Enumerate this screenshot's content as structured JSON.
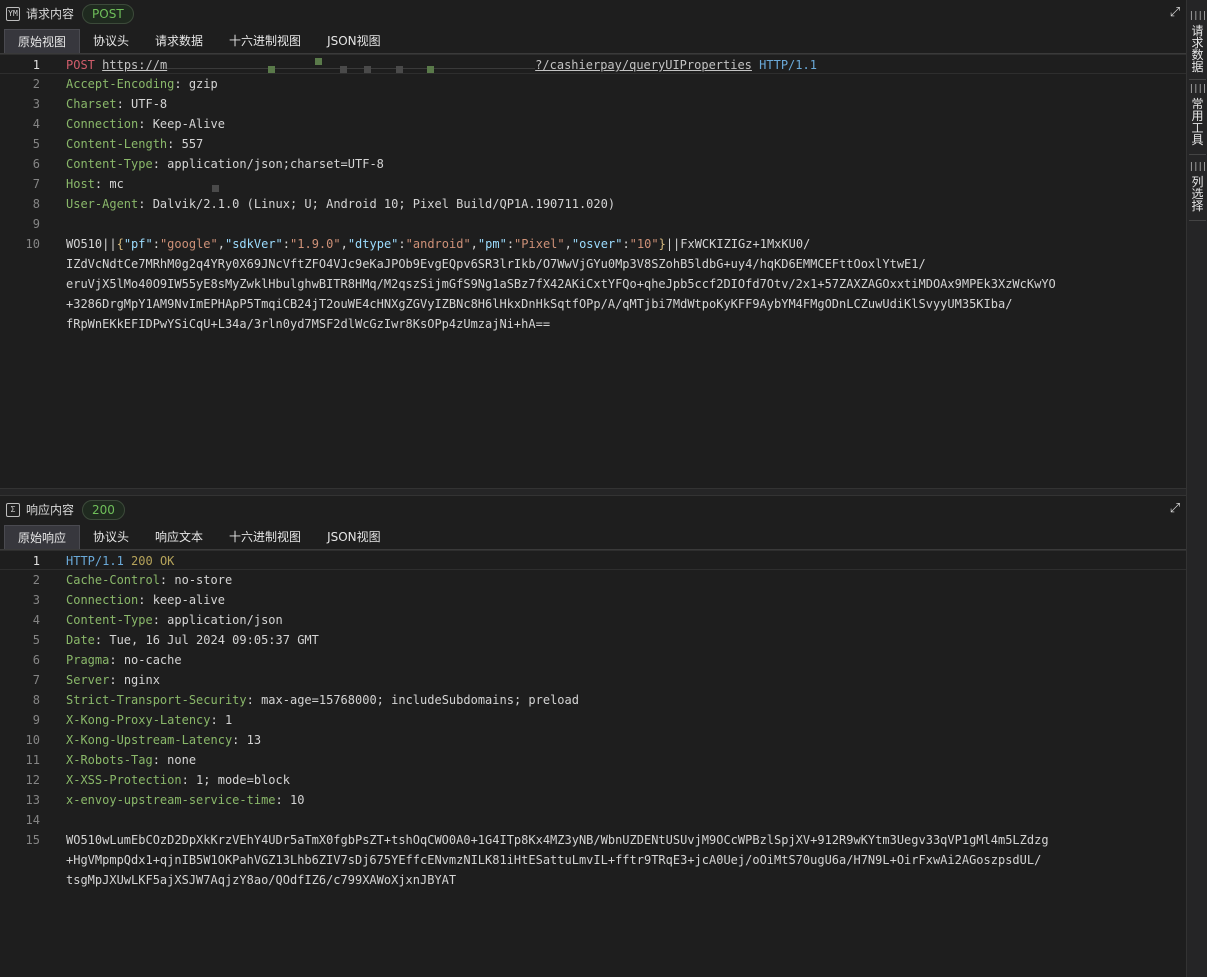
{
  "request": {
    "title": "请求内容",
    "method_badge": "POST",
    "icon": "request-window-icon",
    "tabs": [
      "原始视图",
      "协议头",
      "请求数据",
      "十六进制视图",
      "JSON视图"
    ],
    "line_numbers": [
      "1",
      "2",
      "3",
      "4",
      "5",
      "6",
      "7",
      "8",
      "9",
      "10"
    ],
    "start_line": {
      "method": "POST",
      "url_start": "https://m",
      "url_end": "?/cashierpay/queryUIProperties",
      "version": "HTTP/1.1"
    },
    "headers": [
      {
        "name": "Accept-Encoding",
        "value": "gzip"
      },
      {
        "name": "Charset",
        "value": "UTF-8"
      },
      {
        "name": "Connection",
        "value": "Keep-Alive"
      },
      {
        "name": "Content-Length",
        "value": "557"
      },
      {
        "name": "Content-Type",
        "value": "application/json;charset=UTF-8"
      },
      {
        "name": "Host",
        "value": "mc"
      },
      {
        "name": "User-Agent",
        "value": "Dalvik/2.1.0 (Linux; U; Android 10; Pixel Build/QP1A.190711.020)"
      }
    ],
    "body": {
      "prefix": "WO510||",
      "json_pairs": [
        {
          "key": "\"pf\"",
          "value": "\"google\""
        },
        {
          "key": "\"sdkVer\"",
          "value": "\"1.9.0\""
        },
        {
          "key": "\"dtype\"",
          "value": "\"android\""
        },
        {
          "key": "\"pm\"",
          "value": "\"Pixel\""
        },
        {
          "key": "\"osver\"",
          "value": "\"10\""
        }
      ],
      "after_json": "||FxWCKIZIGz+1MxKU0/",
      "wrap_lines": [
        "IZdVcNdtCe7MRhM0g2q4YRy0X69JNcVftZFO4VJc9eKaJPOb9EvgEQpv6SR3lrIkb/O7WwVjGYu0Mp3V8SZohB5ldbG+uy4/hqKD6EMMCEFttOoxlYtwE1/",
        "eruVjX5lMo40O9IW55yE8sMyZwklHbulghwBITR8HMq/M2qszSijmGfS9Ng1aSBz7fX42AKiCxtYFQo+qheJpb5ccf2DIOfd7Otv/2x1+57ZAXZAGOxxtiMDOAx9MPEk3XzWcKwYO",
        "+3286DrgMpY1AM9NvImEPHApP5TmqiCB24jT2ouWE4cHNXgZGVyIZBNc8H6lHkxDnHkSqtfOPp/A/qMTjbi7MdWtpoKyKFF9AybYM4FMgODnLCZuwUdiKlSvyyUM35KIba/",
        "fRpWnEKkEFIDPwYSiCqU+L34a/3rln0yd7MSF2dlWcGzIwr8KsOPp4zUmzajNi+hA=="
      ]
    }
  },
  "response": {
    "title": "响应内容",
    "status_badge": "200",
    "icon": "sigma-icon",
    "tabs": [
      "原始响应",
      "协议头",
      "响应文本",
      "十六进制视图",
      "JSON视图"
    ],
    "line_numbers": [
      "1",
      "2",
      "3",
      "4",
      "5",
      "6",
      "7",
      "8",
      "9",
      "10",
      "11",
      "12",
      "13",
      "14",
      "15"
    ],
    "status_line": {
      "version": "HTTP/1.1",
      "code": "200",
      "reason": "OK"
    },
    "headers": [
      {
        "name": "Cache-Control",
        "value": "no-store"
      },
      {
        "name": "Connection",
        "value": "keep-alive"
      },
      {
        "name": "Content-Type",
        "value": "application/json"
      },
      {
        "name": "Date",
        "value": "Tue, 16 Jul 2024 09:05:37 GMT"
      },
      {
        "name": "Pragma",
        "value": "no-cache"
      },
      {
        "name": "Server",
        "value": "nginx"
      },
      {
        "name": "Strict-Transport-Security",
        "value": "max-age=15768000; includeSubdomains; preload"
      },
      {
        "name": "X-Kong-Proxy-Latency",
        "value": "1"
      },
      {
        "name": "X-Kong-Upstream-Latency",
        "value": "13"
      },
      {
        "name": "X-Robots-Tag",
        "value": "none"
      },
      {
        "name": "X-XSS-Protection",
        "value": "1; mode=block"
      },
      {
        "name": "x-envoy-upstream-service-time",
        "value": "10"
      }
    ],
    "body_lines": [
      "WO510wLumEbCOzD2DpXkKrzVEhY4UDr5aTmX0fgbPsZT+tshOqCWO0A0+1G4ITp8Kx4MZ3yNB/WbnUZDENtUSUvjM9OCcWPBzlSpjXV+912R9wKYtm3Uegv33qVP1gMl4m5LZdzg",
      "+HgVMpmpQdx1+qjnIB5W1OKPahVGZ13Lhb6ZIV7sDj675YEffcENvmzNILK81iHtESattuLmvIL+fftr9TRqE3+jcA0Uej/oOiMtS70ugU6a/H7N9L+OirFxwAi2AGoszpsdUL/",
      "tsgMpJXUwLKF5ajXSJW7AqjzY8ao/QOdfIZ6/c799XAWoXjxnJBYAT"
    ]
  },
  "sidebar": {
    "tabs": [
      {
        "label": "请求数据",
        "grip": "||||"
      },
      {
        "label": "常用工具",
        "grip": "||||"
      },
      {
        "label": "列选择",
        "grip": "||||"
      }
    ]
  },
  "punct": {
    "colon": ": ",
    "comma": ",",
    "sep": ":",
    "open": "{",
    "close": "}"
  }
}
